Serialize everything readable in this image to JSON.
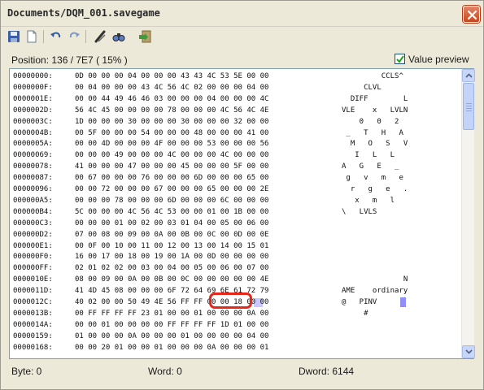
{
  "window": {
    "title": "Documents/DQM_001.savegame",
    "close_glyph": "×"
  },
  "toolbar": {
    "buttons": [
      {
        "name": "save-icon"
      },
      {
        "name": "new-document-icon"
      },
      {
        "name": "undo-icon"
      },
      {
        "name": "redo-icon"
      },
      {
        "name": "goto-icon"
      },
      {
        "name": "find-icon"
      },
      {
        "name": "exit-icon"
      }
    ]
  },
  "header": {
    "position_text": "Position: 136 / 7E7 ( 15% )",
    "value_preview_label": "Value preview",
    "value_preview_checked": true
  },
  "hex_rows": [
    {
      "addr": "00000000:",
      "bytes": "0D 00 00 00 04 00 00 00 43 43 4C 53 5E 00 00",
      "ascii": "         CCLS^"
    },
    {
      "addr": "0000000F:",
      "bytes": "00 04 00 00 00 43 4C 56 4C 02 00 00 00 04 00",
      "ascii": "     CLVL"
    },
    {
      "addr": "0000001E:",
      "bytes": "00 00 44 49 46 46 03 00 00 00 04 00 00 00 4C",
      "ascii": "  DIFF        L"
    },
    {
      "addr": "0000002D:",
      "bytes": "56 4C 45 00 00 00 00 78 00 00 00 4C 56 4C 4E",
      "ascii": "VLE    x   LVLN"
    },
    {
      "addr": "0000003C:",
      "bytes": "1D 00 00 00 30 00 00 00 30 00 00 00 32 00 00",
      "ascii": "    0   0   2"
    },
    {
      "addr": "0000004B:",
      "bytes": "00 5F 00 00 00 54 00 00 00 48 00 00 00 41 00",
      "ascii": " _   T   H   A"
    },
    {
      "addr": "0000005A:",
      "bytes": "00 00 4D 00 00 00 4F 00 00 00 53 00 00 00 56",
      "ascii": "  M   O   S   V"
    },
    {
      "addr": "00000069:",
      "bytes": "00 00 00 49 00 00 00 4C 00 00 00 4C 00 00 00",
      "ascii": "   I   L   L"
    },
    {
      "addr": "00000078:",
      "bytes": "41 00 00 00 47 00 00 00 45 00 00 00 5F 00 00",
      "ascii": "A   G   E   _"
    },
    {
      "addr": "00000087:",
      "bytes": "00 67 00 00 00 76 00 00 00 6D 00 00 00 65 00",
      "ascii": " g   v   m   e"
    },
    {
      "addr": "00000096:",
      "bytes": "00 00 72 00 00 00 67 00 00 00 65 00 00 00 2E",
      "ascii": "  r   g   e   ."
    },
    {
      "addr": "000000A5:",
      "bytes": "00 00 00 78 00 00 00 6D 00 00 00 6C 00 00 00",
      "ascii": "   x   m   l"
    },
    {
      "addr": "000000B4:",
      "bytes": "5C 00 00 00 4C 56 4C 53 00 00 01 00 1B 00 00",
      "ascii": "\\   LVLS"
    },
    {
      "addr": "000000C3:",
      "bytes": "00 00 00 01 00 02 00 03 01 04 00 05 00 06 00",
      "ascii": ""
    },
    {
      "addr": "000000D2:",
      "bytes": "07 00 08 00 09 00 0A 00 0B 00 0C 00 0D 00 0E",
      "ascii": ""
    },
    {
      "addr": "000000E1:",
      "bytes": "00 0F 00 10 00 11 00 12 00 13 00 14 00 15 01",
      "ascii": ""
    },
    {
      "addr": "000000F0:",
      "bytes": "16 00 17 00 18 00 19 00 1A 00 0D 00 00 00 00",
      "ascii": ""
    },
    {
      "addr": "000000FF:",
      "bytes": "02 01 02 02 00 03 00 04 00 05 00 06 00 07 00",
      "ascii": ""
    },
    {
      "addr": "0000010E:",
      "bytes": "08 00 09 00 0A 00 0B 00 0C 00 00 00 00 00 4E",
      "ascii": "              N"
    },
    {
      "addr": "0000011D:",
      "bytes": "41 4D 45 08 00 00 00 6F 72 64 69 6E 61 72 79",
      "ascii": "AME    ordinary"
    },
    {
      "addr": "0000012C:",
      "bytes": "40 02 00 00 50 49 4E 56 FF FF 00 00 18 00 00",
      "ascii": "@   PINV"
    },
    {
      "addr": "0000013B:",
      "bytes": "00 FF FF FF FF 23 01 00 00 01 00 00 00 0A 00",
      "ascii": "     #"
    },
    {
      "addr": "0000014A:",
      "bytes": "00 00 01 00 00 00 00 FF FF FF FF 1D 01 00 00",
      "ascii": ""
    },
    {
      "addr": "00000159:",
      "bytes": "01 00 00 00 0A 00 00 00 01 00 00 00 00 04 00",
      "ascii": ""
    },
    {
      "addr": "00000168:",
      "bytes": "00 00 20 01 00 00 01 00 00 00 0A 00 00 00 01",
      "ascii": ""
    }
  ],
  "selection": {
    "annotated_bytes": "FF FF",
    "annotation_color": "#e8261a",
    "cursor_color": "#8f8ff7"
  },
  "status": {
    "byte_text": "Byte: 0",
    "word_text": "Word: 0",
    "dword_text": "Dword: 6144"
  }
}
